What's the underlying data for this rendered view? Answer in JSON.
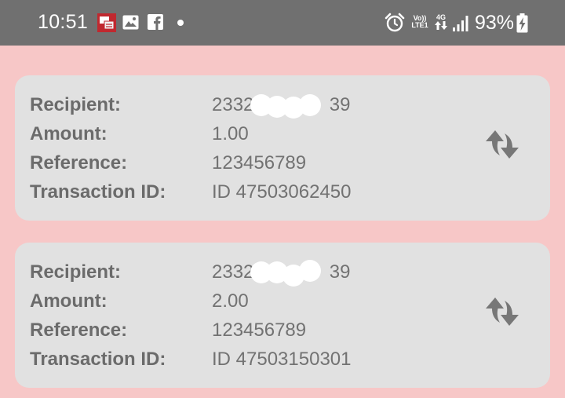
{
  "status_bar": {
    "time": "10:51",
    "net_top": "Vo))",
    "net_bottom": "LTE1",
    "gen": "4G",
    "battery": "93%",
    "icons": [
      "mail-icon",
      "image-icon",
      "facebook-icon",
      "dot-icon",
      "alarm-icon",
      "volte-icon",
      "data-icon",
      "signal-icon",
      "battery-charging-icon"
    ]
  },
  "labels": {
    "recipient": "Recipient:",
    "amount": "Amount:",
    "reference": "Reference:",
    "transaction_id": "Transaction ID:"
  },
  "transactions": [
    {
      "recipient_prefix": "23324",
      "recipient_suffix": "39",
      "amount": "1.00",
      "reference": "123456789",
      "transaction_id": "ID 47503062450",
      "action_icon": "refresh-icon"
    },
    {
      "recipient_prefix": "23324",
      "recipient_suffix": "39",
      "amount": "2.00",
      "reference": "123456789",
      "transaction_id": "ID 47503150301",
      "action_icon": "refresh-icon"
    }
  ],
  "colors": {
    "background": "#f7c7c7",
    "status_bar": "#707070",
    "card": "#e1e1e1",
    "text": "#6b6b6b"
  }
}
